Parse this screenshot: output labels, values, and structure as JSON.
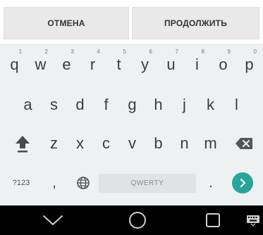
{
  "action_bar": {
    "cancel_label": "ОТМЕНА",
    "continue_label": "ПРОДОЛЖИТЬ"
  },
  "keyboard": {
    "row1": [
      {
        "key": "q",
        "hint": "1"
      },
      {
        "key": "w",
        "hint": "2"
      },
      {
        "key": "e",
        "hint": "3"
      },
      {
        "key": "r",
        "hint": "4"
      },
      {
        "key": "t",
        "hint": "5"
      },
      {
        "key": "y",
        "hint": "6"
      },
      {
        "key": "u",
        "hint": "7"
      },
      {
        "key": "i",
        "hint": "8"
      },
      {
        "key": "o",
        "hint": "9"
      },
      {
        "key": "p",
        "hint": "0"
      }
    ],
    "row2": [
      "a",
      "s",
      "d",
      "f",
      "g",
      "h",
      "j",
      "k",
      "l"
    ],
    "row3": [
      "z",
      "x",
      "c",
      "v",
      "b",
      "n",
      "m"
    ],
    "symbols_label": "?123",
    "comma_label": ",",
    "space_label": "QWERTY",
    "period_label": ".",
    "icons": {
      "shift": "shift-icon",
      "backspace": "backspace-icon",
      "language": "globe-icon",
      "enter": "enter-arrow-icon"
    },
    "colors": {
      "enter_accent": "#26a69a"
    }
  },
  "navigation_bar": {
    "icons": [
      "back-icon",
      "home-icon",
      "recents-icon",
      "keyboard-switch-icon"
    ]
  }
}
